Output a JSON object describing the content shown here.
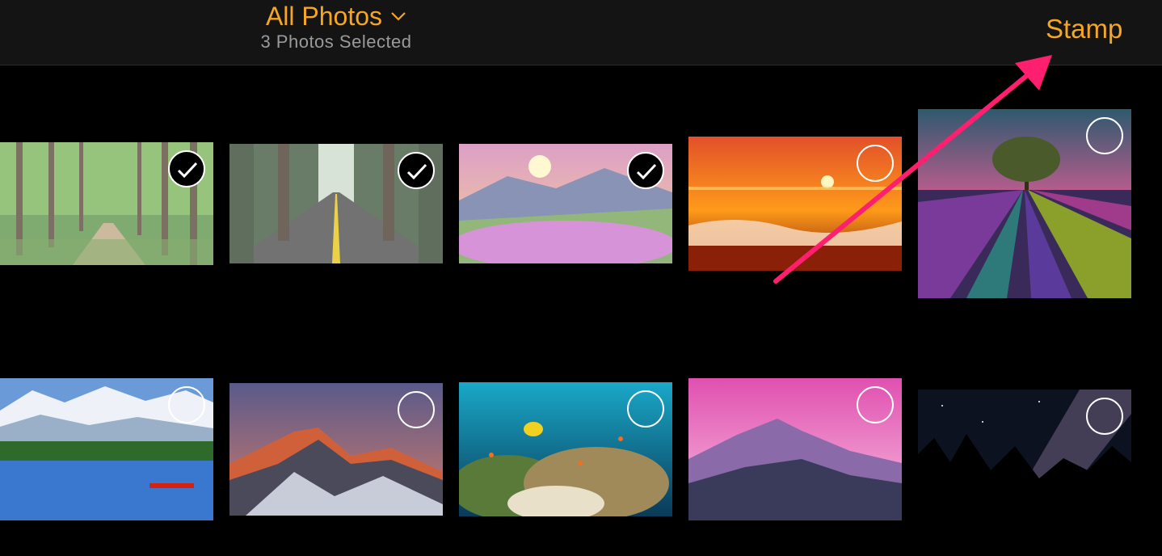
{
  "header": {
    "title": "All Photos",
    "subtitle": "3 Photos Selected",
    "stamp_label": "Stamp"
  },
  "colors": {
    "accent": "#f5a623",
    "annotation_arrow": "#ff1f6e"
  },
  "photos": [
    {
      "name": "forest-path",
      "selected": true
    },
    {
      "name": "forest-road",
      "selected": true
    },
    {
      "name": "flower-meadow-sunrise",
      "selected": true
    },
    {
      "name": "ocean-sunset",
      "selected": false
    },
    {
      "name": "lavender-field-tree",
      "selected": false
    },
    {
      "name": "lake-canoe-mountains",
      "selected": false
    },
    {
      "name": "mountain-sunset",
      "selected": false
    },
    {
      "name": "coral-reef",
      "selected": false
    },
    {
      "name": "pink-sky-mountains",
      "selected": false
    },
    {
      "name": "milky-way-forest",
      "selected": false
    }
  ]
}
